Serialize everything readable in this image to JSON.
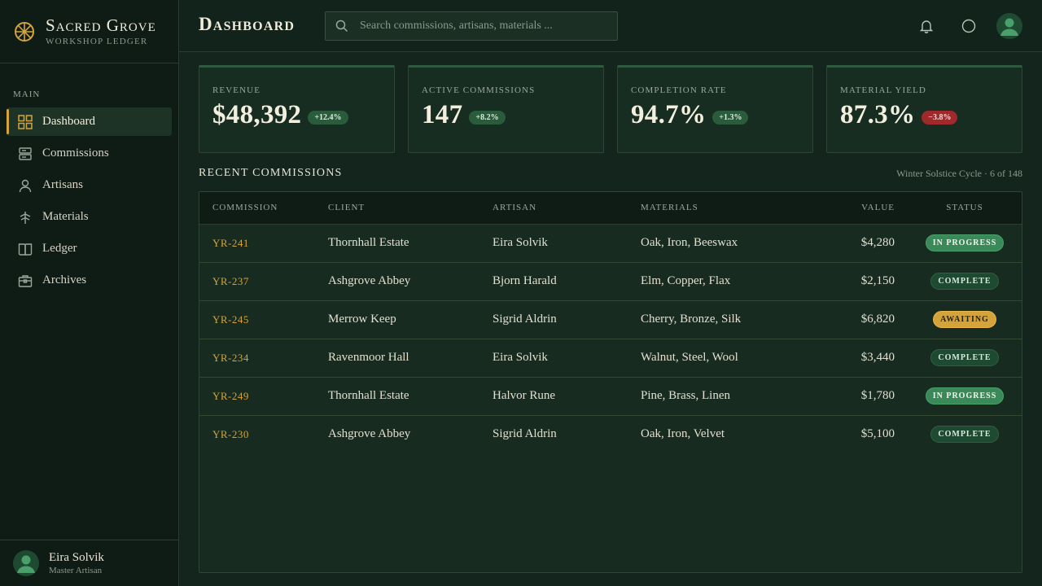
{
  "brand": {
    "name": "Sacred Grove",
    "subtitle": "Workshop Ledger"
  },
  "sidebar": {
    "section_label": "Main",
    "items": [
      {
        "label": "Dashboard",
        "icon": "grid-icon",
        "active": true
      },
      {
        "label": "Commissions",
        "icon": "scroll-icon",
        "active": false
      },
      {
        "label": "Artisans",
        "icon": "person-icon",
        "active": false
      },
      {
        "label": "Materials",
        "icon": "tree-icon",
        "active": false
      },
      {
        "label": "Ledger",
        "icon": "book-icon",
        "active": false
      },
      {
        "label": "Archives",
        "icon": "chest-icon",
        "active": false
      }
    ],
    "user": {
      "name": "Eira Solvik",
      "role": "Master Artisan"
    }
  },
  "header": {
    "title": "Dashboard",
    "search_placeholder": "Search commissions, artisans, materials ..."
  },
  "stats": [
    {
      "label": "Revenue",
      "value": "$48,392",
      "delta": "+12.4%",
      "positive": true
    },
    {
      "label": "Active Commissions",
      "value": "147",
      "delta": "+8.2%",
      "positive": true
    },
    {
      "label": "Completion Rate",
      "value": "94.7%",
      "delta": "+1.3%",
      "positive": true
    },
    {
      "label": "Material Yield",
      "value": "87.3%",
      "delta": "−3.8%",
      "positive": false
    }
  ],
  "commissions": {
    "title": "Recent Commissions",
    "meta": "Winter Solstice Cycle · 6 of 148",
    "columns": [
      "Commission",
      "Client",
      "Artisan",
      "Materials",
      "Value",
      "Status"
    ],
    "rows": [
      {
        "id": "YR-241",
        "client": "Thornhall Estate",
        "artisan": "Eira Solvik",
        "materials": "Oak, Iron, Beeswax",
        "value": "$4,280",
        "status": "In Progress"
      },
      {
        "id": "YR-237",
        "client": "Ashgrove Abbey",
        "artisan": "Bjorn Harald",
        "materials": "Elm, Copper, Flax",
        "value": "$2,150",
        "status": "Complete"
      },
      {
        "id": "YR-245",
        "client": "Merrow Keep",
        "artisan": "Sigrid Aldrin",
        "materials": "Cherry, Bronze, Silk",
        "value": "$6,820",
        "status": "Awaiting"
      },
      {
        "id": "YR-234",
        "client": "Ravenmoor Hall",
        "artisan": "Eira Solvik",
        "materials": "Walnut, Steel, Wool",
        "value": "$3,440",
        "status": "Complete"
      },
      {
        "id": "YR-249",
        "client": "Thornhall Estate",
        "artisan": "Halvor Rune",
        "materials": "Pine, Brass, Linen",
        "value": "$1,780",
        "status": "In Progress"
      },
      {
        "id": "YR-230",
        "client": "Ashgrove Abbey",
        "artisan": "Sigrid Aldrin",
        "materials": "Oak, Iron, Velvet",
        "value": "$5,100",
        "status": "Complete"
      }
    ]
  },
  "colors": {
    "accent": "#d4a43a",
    "background": "#14251d",
    "sidebar": "#0f1c16",
    "positive": "#2a5c3c",
    "negative": "#a0292c"
  }
}
